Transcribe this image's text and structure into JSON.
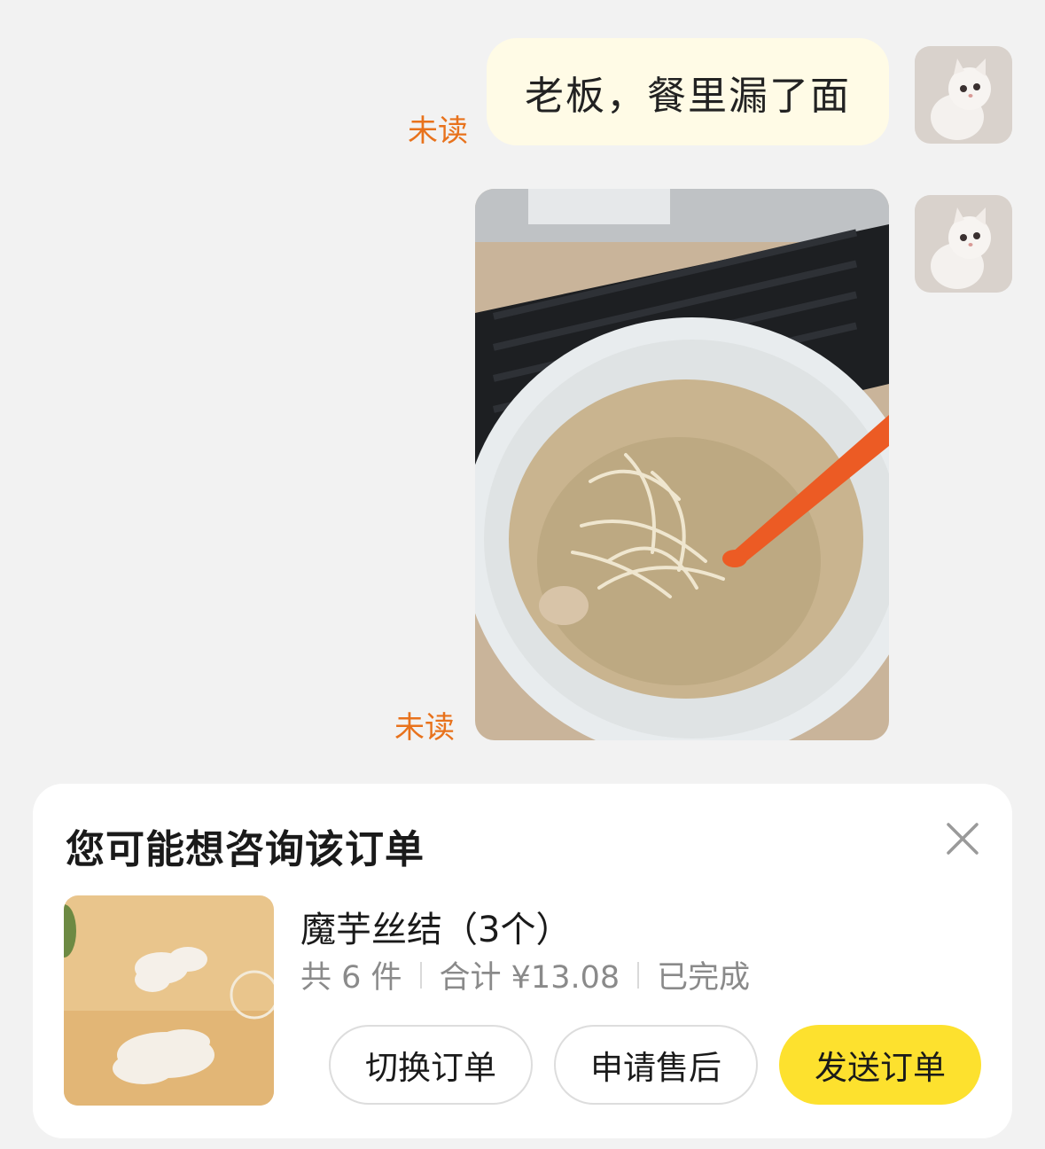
{
  "messages": [
    {
      "type": "text",
      "text": "老板，餐里漏了面",
      "status": "未读",
      "avatar": "cat-avatar-icon"
    },
    {
      "type": "image",
      "status": "未读",
      "avatar": "cat-avatar-icon"
    }
  ],
  "order_card": {
    "title": "您可能想咨询该订单",
    "item_name": "魔芋丝结（3个）",
    "count": "共 6 件",
    "total": "合计 ¥13.08",
    "status": "已完成",
    "buttons": {
      "switch": "切换订单",
      "after_sale": "申请售后",
      "send": "发送订单"
    }
  },
  "colors": {
    "background": "#f2f2f2",
    "bubble": "#fffbe6",
    "unread": "#e8721c",
    "primary_button": "#fde12e"
  }
}
